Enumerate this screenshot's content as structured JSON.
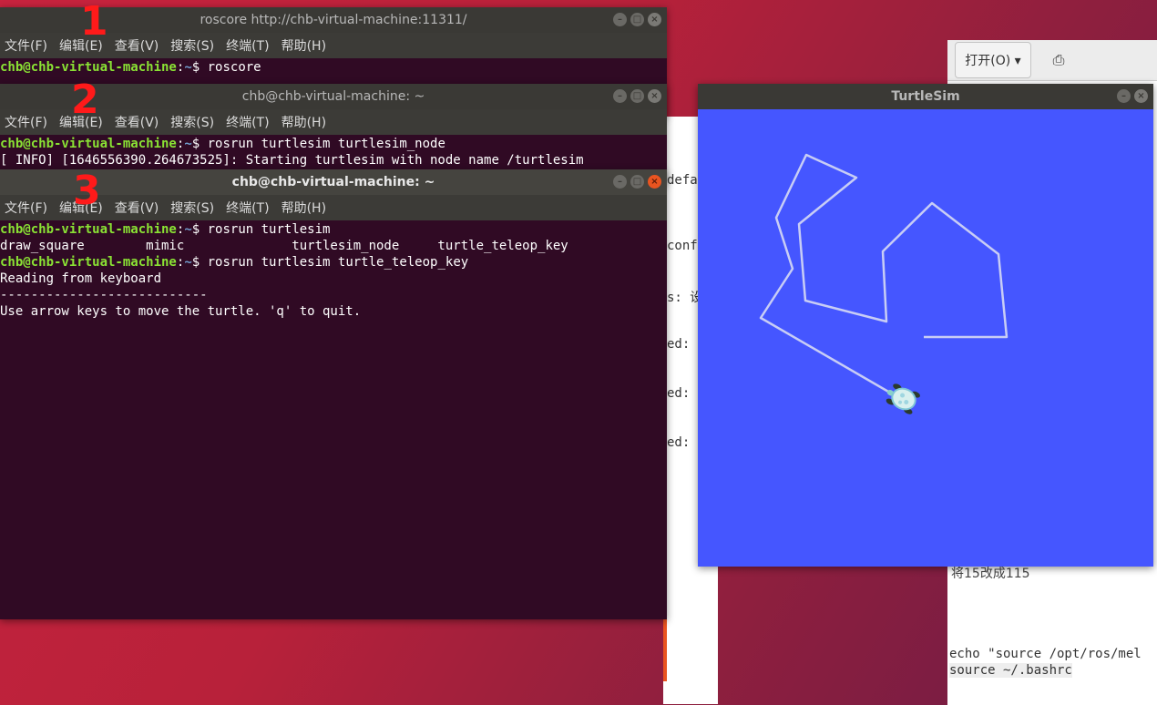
{
  "background": {
    "right_window": {
      "open_button": "打开(O)",
      "save_icon": "document-save-icon",
      "note": "将15改成115",
      "code_line_1": "echo \"source /opt/ros/mel",
      "code_line_2": "source ~/.bashrc"
    },
    "mid_window": {
      "fragments": [
        "defa",
        "conf",
        "s: 设",
        "ed:",
        "ed:",
        "ed:"
      ]
    }
  },
  "windows": {
    "roscore": {
      "title": "roscore http://chb-virtual-machine:11311/",
      "menu": [
        "文件(F)",
        "编辑(E)",
        "查看(V)",
        "搜索(S)",
        "终端(T)",
        "帮助(H)"
      ],
      "prompt_user": "chb@chb-virtual-machine",
      "prompt_path": "~",
      "command": "$ roscore"
    },
    "node": {
      "title": "chb@chb-virtual-machine: ~",
      "menu": [
        "文件(F)",
        "编辑(E)",
        "查看(V)",
        "搜索(S)",
        "终端(T)",
        "帮助(H)"
      ],
      "prompt_user": "chb@chb-virtual-machine",
      "prompt_path": "~",
      "command": "$ rosrun turtlesim turtlesim_node",
      "output": "[ INFO] [1646556390.264673525]: Starting turtlesim with node name /turtlesim"
    },
    "teleop": {
      "title": "chb@chb-virtual-machine: ~",
      "menu": [
        "文件(F)",
        "编辑(E)",
        "查看(V)",
        "搜索(S)",
        "终端(T)",
        "帮助(H)"
      ],
      "prompt_user": "chb@chb-virtual-machine",
      "prompt_path": "~",
      "command1": "$ rosrun turtlesim",
      "completions": "draw_square        mimic              turtlesim_node     turtle_teleop_key",
      "command2": "$ rosrun turtlesim turtle_teleop_key",
      "line_reading": "Reading from keyboard",
      "line_sep": "---------------------------",
      "line_help": "Use arrow keys to move the turtle. 'q' to quit."
    },
    "turtlesim": {
      "title": "TurtleSim",
      "background_color": "#4556ff",
      "path_color": "#c8cdf5"
    }
  },
  "annotations": [
    "1",
    "2",
    "3"
  ],
  "colors": {
    "terminal_bg": "#300a24",
    "prompt_user": "#8ae234",
    "prompt_path": "#729fcf",
    "accent_close": "#e95420"
  }
}
